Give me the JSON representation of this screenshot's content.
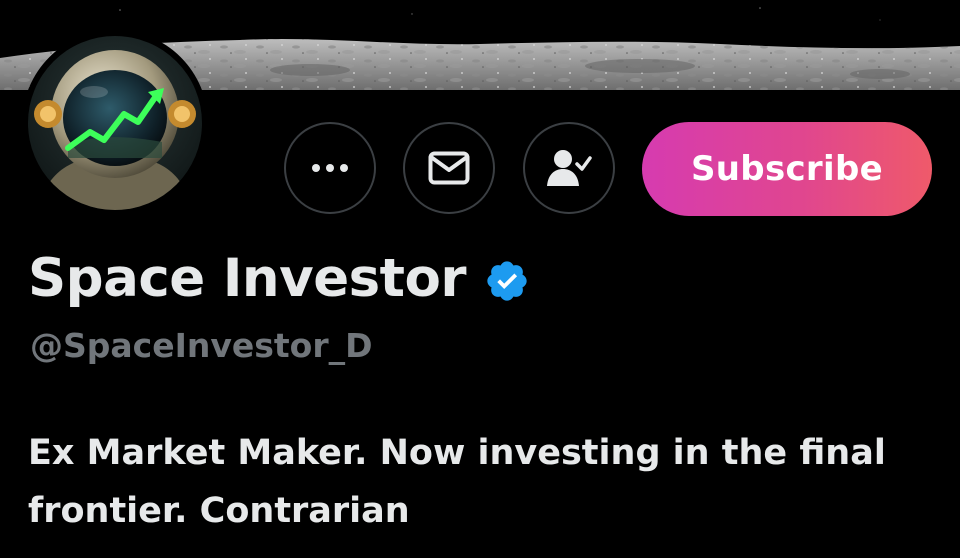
{
  "colors": {
    "background": "#000000",
    "text_primary": "#e7e9ea",
    "text_secondary": "#71767b",
    "verified": "#1d9bf0",
    "subscribe_gradient_start": "#d63bb0",
    "subscribe_gradient_end": "#ef5a6a"
  },
  "header": {
    "banner_image": "moon-surface-banner",
    "avatar_image": "astronaut-green-chart-avatar"
  },
  "actions": {
    "more_icon": "more-dots-icon",
    "message_icon": "envelope-icon",
    "follow_icon": "person-check-icon",
    "subscribe_label": "Subscribe"
  },
  "profile": {
    "display_name": "Space Investor",
    "verified_icon": "verified-badge-icon",
    "handle": "@SpaceInvestor_D",
    "bio": "Ex Market Maker. Now investing in the final frontier. Contrarian"
  }
}
